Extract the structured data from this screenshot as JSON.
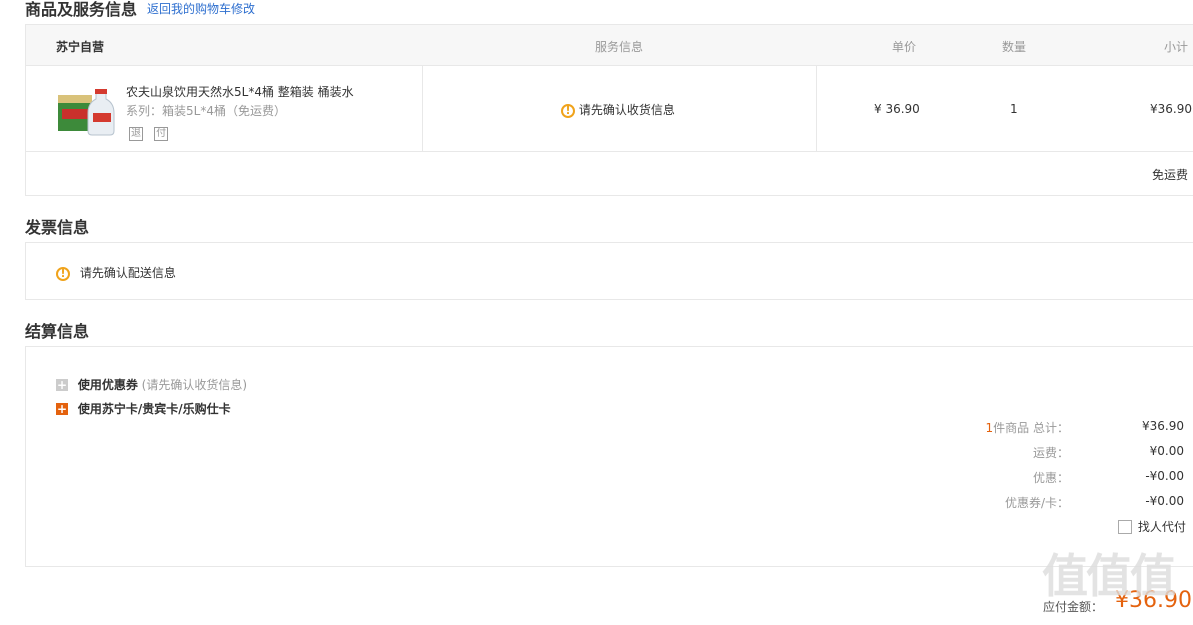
{
  "goods_section": {
    "title": "商品及服务信息",
    "back_link": "返回我的购物车修改",
    "shop_name": "苏宁自营",
    "headers": {
      "service": "服务信息",
      "price": "单价",
      "qty": "数量",
      "subtotal": "小计"
    },
    "item": {
      "name": "农夫山泉饮用天然水5L*4桶 整箱装 桶装水",
      "spec": "系列：箱装5L*4桶（免运费）",
      "tags": [
        "退",
        "付"
      ],
      "service_notice": "请先确认收货信息",
      "price": "¥ 36.90",
      "qty": "1",
      "subtotal": "¥36.90"
    },
    "shipping_note": "免运费"
  },
  "invoice_section": {
    "title": "发票信息",
    "notice": "请先确认配送信息"
  },
  "settle_section": {
    "title": "结算信息",
    "coupon_label": "使用优惠券",
    "coupon_hint": "(请先确认收货信息)",
    "card_label": "使用苏宁卡/贵宾卡/乐购仕卡",
    "summary": {
      "count": "1",
      "count_suffix": "件商品 总计：",
      "total": "¥36.90",
      "freight_label": "运费：",
      "freight": "¥0.00",
      "discount_label": "优惠：",
      "discount": "-¥0.00",
      "coupon_card_label": "优惠券/卡：",
      "coupon_card": "-¥0.00",
      "pay_for_label": "找人代付"
    },
    "pay_label": "应付金额：",
    "pay_amount": "¥36.90"
  },
  "watermark": "值值值",
  "colors": {
    "accent": "#f0a31b",
    "orange": "#e4620e",
    "link": "#2e6fcf"
  },
  "icons": {
    "warning": "warning-icon",
    "plus": "plus-icon"
  }
}
